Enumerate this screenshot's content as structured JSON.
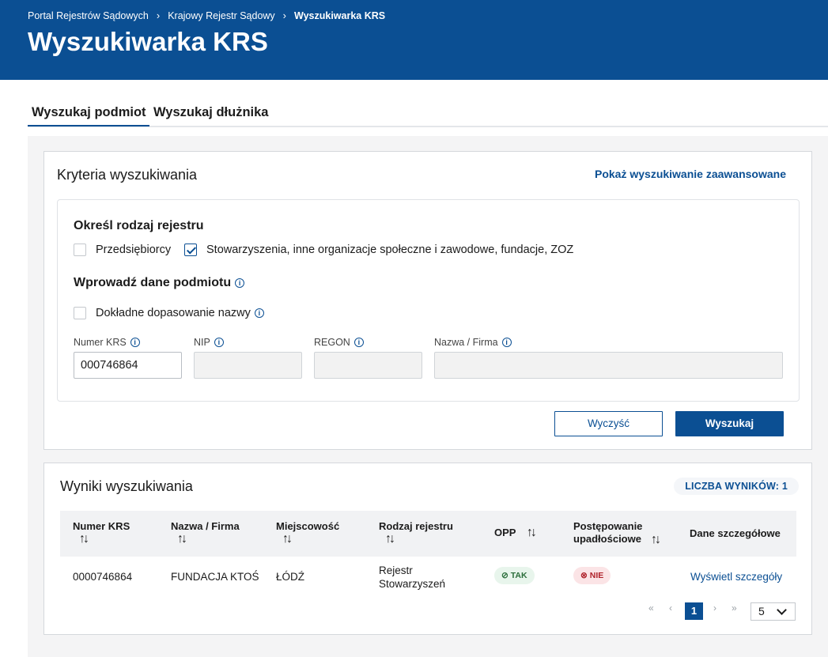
{
  "header": {
    "breadcrumb": [
      "Portal Rejestrów Sądowych",
      "Krajowy Rejestr Sądowy",
      "Wyszukiwarka KRS"
    ],
    "title": "Wyszukiwarka KRS",
    "background_color": "#0b4f93"
  },
  "tabs": [
    {
      "label": "Wyszukaj podmiot",
      "active": true
    },
    {
      "label": "Wyszukaj dłużnika",
      "active": false
    }
  ],
  "criteria": {
    "title": "Kryteria wyszukiwania",
    "advanced_link": "Pokaż wyszukiwanie zaawansowane",
    "register_heading": "Określ rodzaj rejestru",
    "register_options": [
      {
        "label": "Przedsiębiorcy",
        "checked": false
      },
      {
        "label": "Stowarzyszenia, inne organizacje społeczne i zawodowe, fundacje, ZOZ",
        "checked": true
      }
    ],
    "entity_heading": "Wprowadź dane podmiotu",
    "exact_match": {
      "label": "Dokładne dopasowanie nazwy",
      "checked": false
    },
    "fields": [
      {
        "label": "Numer KRS",
        "value": "000746864"
      },
      {
        "label": "NIP",
        "value": ""
      },
      {
        "label": "REGON",
        "value": ""
      },
      {
        "label": "Nazwa / Firma",
        "value": ""
      }
    ],
    "clear_button": "Wyczyść",
    "search_button": "Wyszukaj"
  },
  "results": {
    "title": "Wyniki wyszukiwania",
    "count_label": "LICZBA WYNIKÓW: 1",
    "columns": [
      "Numer KRS",
      "Nazwa / Firma",
      "Miejscowość",
      "Rodzaj rejestru",
      "OPP",
      "Postępowanie upadłościowe",
      "Dane szczegółowe"
    ],
    "rows": [
      {
        "krs": "0000746864",
        "name": "FUNDACJA KTOŚ",
        "city": "ŁÓDŹ",
        "register": "Rejestr Stowarzyszeń",
        "opp": "TAK",
        "bankruptcy": "NIE",
        "details": "Wyświetl szczegóły"
      }
    ],
    "pagination": {
      "current_page": "1",
      "page_size": "5"
    }
  }
}
